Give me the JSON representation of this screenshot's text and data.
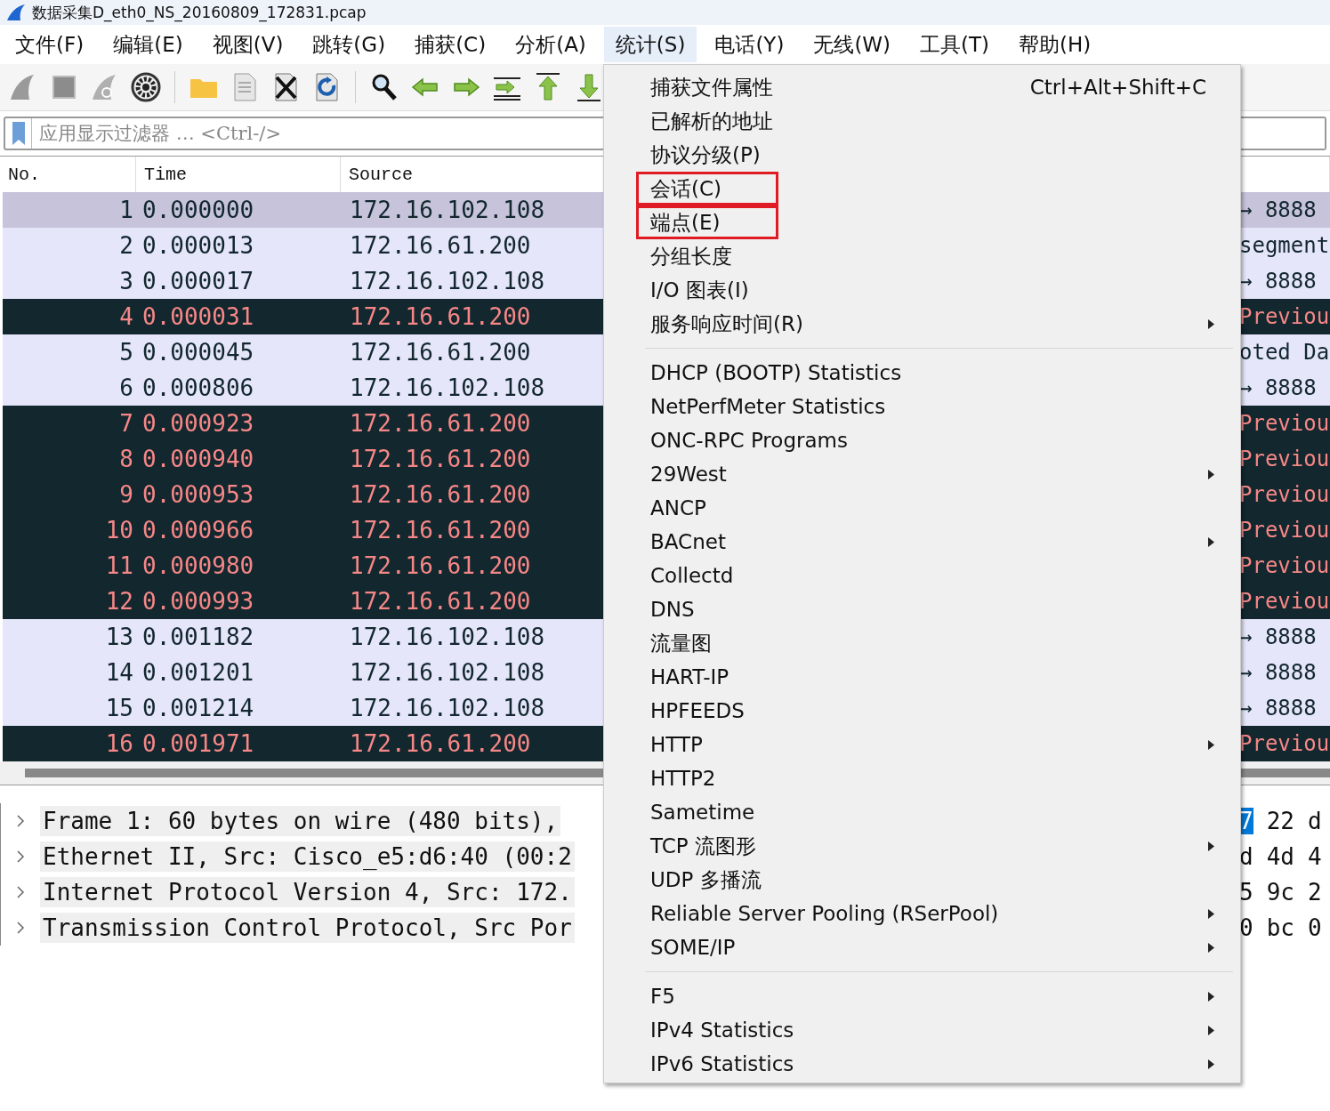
{
  "window": {
    "title": "数据采集D_eth0_NS_20160809_172831.pcap"
  },
  "menubar": [
    {
      "label": "文件(F)",
      "selected": false
    },
    {
      "label": "编辑(E)",
      "selected": false
    },
    {
      "label": "视图(V)",
      "selected": false
    },
    {
      "label": "跳转(G)",
      "selected": false
    },
    {
      "label": "捕获(C)",
      "selected": false
    },
    {
      "label": "分析(A)",
      "selected": false
    },
    {
      "label": "统计(S)",
      "selected": true
    },
    {
      "label": "电话(Y)",
      "selected": false
    },
    {
      "label": "无线(W)",
      "selected": false
    },
    {
      "label": "工具(T)",
      "selected": false
    },
    {
      "label": "帮助(H)",
      "selected": false
    }
  ],
  "filter": {
    "placeholder": "应用显示过滤器 … <Ctrl-/>"
  },
  "packet_list": {
    "columns": [
      "No.",
      "Time",
      "Source"
    ],
    "rows": [
      {
        "no": "1",
        "time": "0.000000",
        "source": "172.16.102.108",
        "info": "→ 8888",
        "kind": "normal",
        "selected": true
      },
      {
        "no": "2",
        "time": "0.000013",
        "source": "172.16.61.200",
        "info": "segment",
        "kind": "normal",
        "selected": false
      },
      {
        "no": "3",
        "time": "0.000017",
        "source": "172.16.102.108",
        "info": "→ 8888",
        "kind": "normal",
        "selected": false
      },
      {
        "no": "4",
        "time": "0.000031",
        "source": "172.16.61.200",
        "info": "Previou",
        "kind": "error",
        "selected": false
      },
      {
        "no": "5",
        "time": "0.000045",
        "source": "172.16.61.200",
        "info": "oted Da",
        "kind": "normal",
        "selected": false
      },
      {
        "no": "6",
        "time": "0.000806",
        "source": "172.16.102.108",
        "info": "→ 8888",
        "kind": "normal",
        "selected": false
      },
      {
        "no": "7",
        "time": "0.000923",
        "source": "172.16.61.200",
        "info": "Previou",
        "kind": "error",
        "selected": false
      },
      {
        "no": "8",
        "time": "0.000940",
        "source": "172.16.61.200",
        "info": "Previou",
        "kind": "error",
        "selected": false
      },
      {
        "no": "9",
        "time": "0.000953",
        "source": "172.16.61.200",
        "info": "Previou",
        "kind": "error",
        "selected": false
      },
      {
        "no": "10",
        "time": "0.000966",
        "source": "172.16.61.200",
        "info": "Previou",
        "kind": "error",
        "selected": false
      },
      {
        "no": "11",
        "time": "0.000980",
        "source": "172.16.61.200",
        "info": "Previou",
        "kind": "error",
        "selected": false
      },
      {
        "no": "12",
        "time": "0.000993",
        "source": "172.16.61.200",
        "info": "Previou",
        "kind": "error",
        "selected": false
      },
      {
        "no": "13",
        "time": "0.001182",
        "source": "172.16.102.108",
        "info": "→ 8888",
        "kind": "normal",
        "selected": false
      },
      {
        "no": "14",
        "time": "0.001201",
        "source": "172.16.102.108",
        "info": "→ 8888",
        "kind": "normal",
        "selected": false
      },
      {
        "no": "15",
        "time": "0.001214",
        "source": "172.16.102.108",
        "info": "→ 8888",
        "kind": "normal",
        "selected": false
      },
      {
        "no": "16",
        "time": "0.001971",
        "source": "172.16.61.200",
        "info": "Previou",
        "kind": "error",
        "selected": false
      }
    ]
  },
  "details": [
    {
      "text": "Frame 1: 60 bytes on wire (480 bits),",
      "expanded": false
    },
    {
      "text": "Ethernet II, Src: Cisco_e5:d6:40 (00:2",
      "expanded": false
    },
    {
      "text": "Internet Protocol Version 4, Src: 172.",
      "expanded": false
    },
    {
      "text": "Transmission Control Protocol, Src Por",
      "expanded": false
    }
  ],
  "hex_lines": [
    {
      "cells": [
        {
          "text": "7",
          "selected": true
        },
        {
          "text": "22",
          "selected": false
        },
        {
          "text": "d",
          "selected": false
        }
      ]
    },
    {
      "cells": [
        {
          "text": "d",
          "selected": false
        },
        {
          "text": "4d",
          "selected": false
        },
        {
          "text": "4",
          "selected": false
        }
      ]
    },
    {
      "cells": [
        {
          "text": "5",
          "selected": false
        },
        {
          "text": "9c",
          "selected": false
        },
        {
          "text": "2",
          "selected": false
        }
      ]
    },
    {
      "cells": [
        {
          "text": "0",
          "selected": false
        },
        {
          "text": "bc",
          "selected": false
        },
        {
          "text": "0",
          "selected": false
        }
      ]
    }
  ],
  "stats_menu": {
    "items": [
      {
        "kind": "item",
        "label": "捕获文件属性",
        "shortcut": "Ctrl+Alt+Shift+C",
        "submenu": false,
        "marked": false
      },
      {
        "kind": "item",
        "label": "已解析的地址",
        "submenu": false,
        "marked": false
      },
      {
        "kind": "item",
        "label": "协议分级(P)",
        "submenu": false,
        "marked": false
      },
      {
        "kind": "item",
        "label": "会话(C)",
        "submenu": false,
        "marked": true
      },
      {
        "kind": "item",
        "label": "端点(E)",
        "submenu": false,
        "marked": true
      },
      {
        "kind": "item",
        "label": "分组长度",
        "submenu": false,
        "marked": false
      },
      {
        "kind": "item",
        "label": "I/O 图表(I)",
        "submenu": false,
        "marked": false
      },
      {
        "kind": "item",
        "label": "服务响应时间(R)",
        "submenu": true,
        "marked": false
      },
      {
        "kind": "separator"
      },
      {
        "kind": "item",
        "label": "DHCP (BOOTP) Statistics",
        "submenu": false,
        "marked": false
      },
      {
        "kind": "item",
        "label": "NetPerfMeter Statistics",
        "submenu": false,
        "marked": false
      },
      {
        "kind": "item",
        "label": "ONC-RPC Programs",
        "submenu": false,
        "marked": false
      },
      {
        "kind": "item",
        "label": "29West",
        "submenu": true,
        "marked": false
      },
      {
        "kind": "item",
        "label": "ANCP",
        "submenu": false,
        "marked": false
      },
      {
        "kind": "item",
        "label": "BACnet",
        "submenu": true,
        "marked": false
      },
      {
        "kind": "item",
        "label": "Collectd",
        "submenu": false,
        "marked": false
      },
      {
        "kind": "item",
        "label": "DNS",
        "submenu": false,
        "marked": false
      },
      {
        "kind": "item",
        "label": "流量图",
        "submenu": false,
        "marked": false
      },
      {
        "kind": "item",
        "label": "HART-IP",
        "submenu": false,
        "marked": false
      },
      {
        "kind": "item",
        "label": "HPFEEDS",
        "submenu": false,
        "marked": false
      },
      {
        "kind": "item",
        "label": "HTTP",
        "submenu": true,
        "marked": false
      },
      {
        "kind": "item",
        "label": "HTTP2",
        "submenu": false,
        "marked": false
      },
      {
        "kind": "item",
        "label": "Sametime",
        "submenu": false,
        "marked": false
      },
      {
        "kind": "item",
        "label": "TCP 流图形",
        "submenu": true,
        "marked": false
      },
      {
        "kind": "item",
        "label": "UDP 多播流",
        "submenu": false,
        "marked": false
      },
      {
        "kind": "item",
        "label": "Reliable Server Pooling (RSerPool)",
        "submenu": true,
        "marked": false
      },
      {
        "kind": "item",
        "label": "SOME/IP",
        "submenu": true,
        "marked": false
      },
      {
        "kind": "separator"
      },
      {
        "kind": "item",
        "label": "F5",
        "submenu": true,
        "marked": false
      },
      {
        "kind": "item",
        "label": "IPv4 Statistics",
        "submenu": true,
        "marked": false
      },
      {
        "kind": "item",
        "label": "IPv6 Statistics",
        "submenu": true,
        "marked": false
      }
    ]
  }
}
